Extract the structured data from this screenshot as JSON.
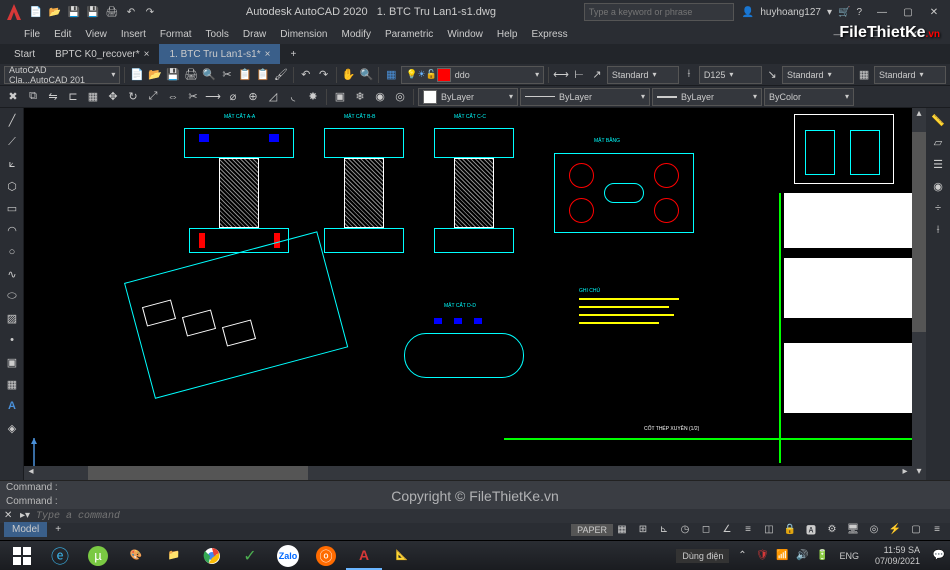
{
  "title": {
    "app": "Autodesk AutoCAD 2020",
    "file": "1. BTC Tru Lan1-s1.dwg"
  },
  "search": {
    "placeholder": "Type a keyword or phrase"
  },
  "user": {
    "name": "huyhoang127"
  },
  "menu": [
    "File",
    "Edit",
    "View",
    "Insert",
    "Format",
    "Tools",
    "Draw",
    "Dimension",
    "Modify",
    "Parametric",
    "Window",
    "Help",
    "Express"
  ],
  "tabs": {
    "start": "Start",
    "t1": "BPTC K0_recover*",
    "t2": "1. BTC Tru Lan1-s1*"
  },
  "layer_dropdown": "ddo",
  "workspace_dropdown": "AutoCAD Cla...AutoCAD 201",
  "prop": {
    "color": "ByLayer",
    "linetype": "ByLayer",
    "lineweight": "ByLayer",
    "plotstyle": "ByColor"
  },
  "dim": {
    "std1": "Standard",
    "d125": "D125",
    "std2": "Standard",
    "std3": "Standard"
  },
  "command": {
    "hist1": "Command :",
    "hist2": "Command :",
    "placeholder": "Type a command"
  },
  "status": {
    "model": "Model",
    "paper": "PAPER",
    "power": "Dùng điện",
    "lang": "ENG",
    "time": "11:59 SA",
    "date": "07/09/2021"
  },
  "cad_labels": {
    "mc_a": "MẶT CẮT A-A",
    "mc_b": "MẶT CẮT B-B",
    "mc_c": "MẶT CẮT C-C",
    "mb": "MẶT BẰNG",
    "ghi_chu": "GHI CHÚ",
    "frame": "CỐT THÉP XUYÊN (1/2)"
  },
  "watermark": {
    "brand": "FileThietKe",
    "suffix": ".vn",
    "copyright": "Copyright © FileThietKe.vn"
  }
}
